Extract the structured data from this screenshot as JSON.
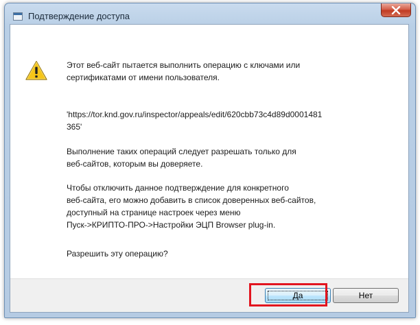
{
  "window": {
    "title": "Подтверждение доступа"
  },
  "dialog": {
    "paragraph1": "Этот веб-сайт пытается выполнить операцию с ключами или\nсертификатами от имени пользователя.",
    "url": "'https://tor.knd.gov.ru/inspector/appeals/edit/620cbb73c4d89d0001481\n365'",
    "paragraph2": "Выполнение таких операций следует разрешать только для\nвеб-сайтов, которым вы доверяете.",
    "paragraph3": "Чтобы отключить данное подтверждение для конкретного\nвеб-сайта, его можно добавить в список доверенных веб-сайтов,\nдоступный на странице настроек через меню\nПуск->КРИПТО-ПРО->Настройки ЭЦП Browser plug-in.",
    "question": "Разрешить эту операцию?"
  },
  "buttons": {
    "yes": "Да",
    "no": "Нет"
  },
  "icons": {
    "app": "window-icon",
    "warning": "warning-icon",
    "close": "close-icon"
  },
  "colors": {
    "highlight": "#e2141f",
    "close_button": "#c9432d",
    "warning_fill": "#f5c518"
  }
}
